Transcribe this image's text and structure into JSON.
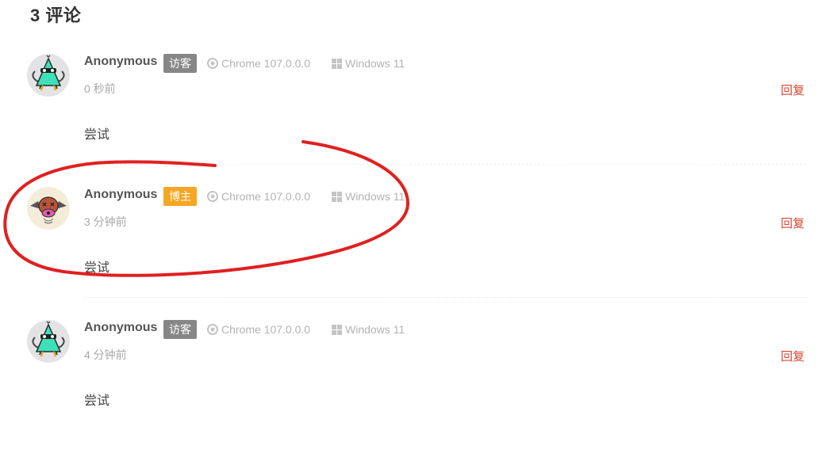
{
  "comments_section": {
    "title": "3 评论",
    "comments": [
      {
        "author": "Anonymous",
        "badge": "访客",
        "badge_color": "#878787",
        "browser": "Chrome 107.0.0.0",
        "os": "Windows 11",
        "time": "0 秒前",
        "reply": "回复",
        "content": "尝试",
        "avatar": "doodle-cone-avatar"
      },
      {
        "author": "Anonymous",
        "badge": "博主",
        "badge_color": "#f6a623",
        "browser": "Chrome 107.0.0.0",
        "os": "Windows 11",
        "time": "3 分钟前",
        "reply": "回复",
        "content": "尝试",
        "avatar": "doodle-bat-avatar"
      },
      {
        "author": "Anonymous",
        "badge": "访客",
        "badge_color": "#878787",
        "browser": "Chrome 107.0.0.0",
        "os": "Windows 11",
        "time": "4 分钟前",
        "reply": "回复",
        "content": "尝试",
        "avatar": "doodle-cone-avatar"
      }
    ]
  },
  "colors": {
    "reply": "#d84532",
    "annotation": "#e02020"
  }
}
